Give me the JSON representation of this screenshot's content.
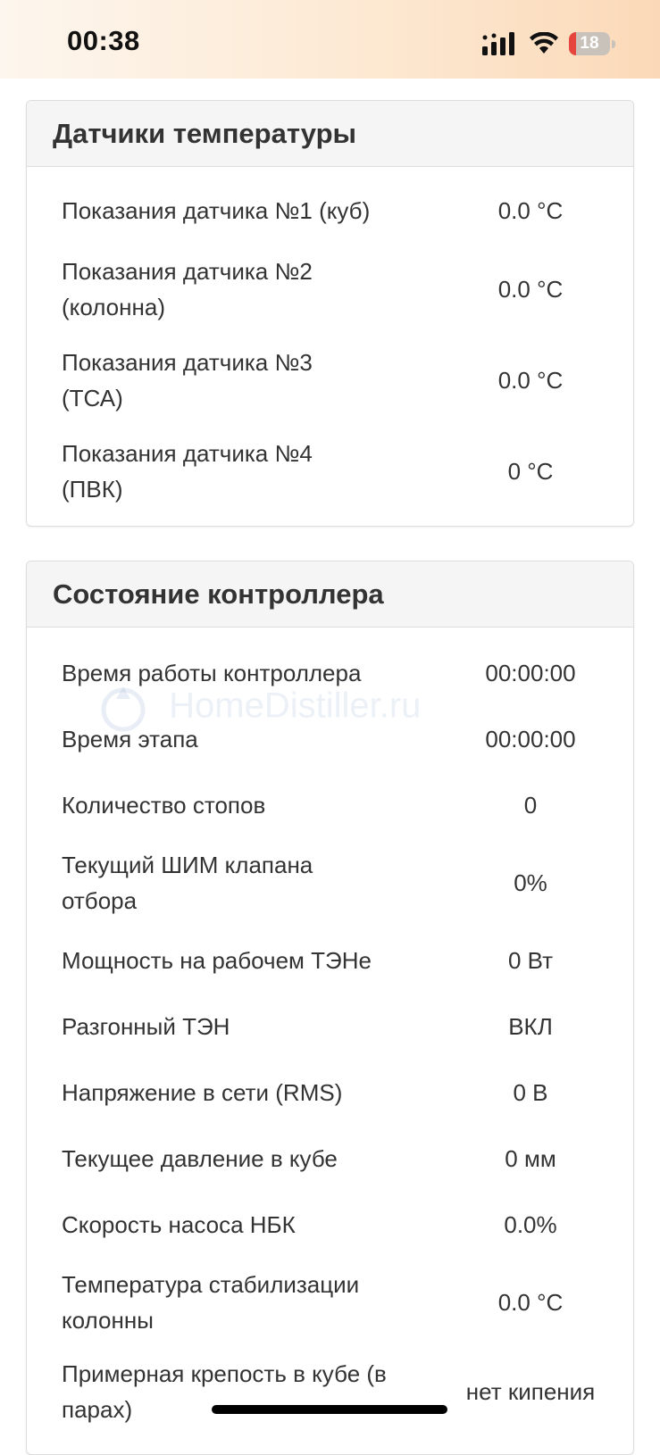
{
  "status_bar": {
    "time": "00:38",
    "battery_level": "18",
    "battery_fraction": 0.18,
    "icons": [
      "cellular-signal-icon",
      "wifi-icon",
      "battery-icon"
    ],
    "battery_color": "#e5453c"
  },
  "temperature_panel": {
    "title": "Датчики температуры",
    "rows": [
      {
        "label": "Показания датчика №1 (куб)",
        "value": "0.0 °C"
      },
      {
        "label": "Показания датчика №2 (колонна)",
        "value": "0.0 °C"
      },
      {
        "label": "Показания датчика №3 (ТСА)",
        "value": "0.0 °C"
      },
      {
        "label": "Показания датчика №4 (ПВК)",
        "value": "0 °C"
      }
    ]
  },
  "controller_panel": {
    "title": "Состояние контроллера",
    "rows": [
      {
        "label": "Время работы контроллера",
        "value": "00:00:00"
      },
      {
        "label": "Время этапа",
        "value": "00:00:00"
      },
      {
        "label": "Количество стопов",
        "value": "0"
      },
      {
        "label": "Текущий ШИМ клапана отбора",
        "value": "0%"
      },
      {
        "label": "Мощность на рабочем ТЭНе",
        "value": "0 Вт"
      },
      {
        "label": "Разгонный ТЭН",
        "value": "ВКЛ"
      },
      {
        "label": "Напряжение в сети (RMS)",
        "value": "0 В"
      },
      {
        "label": "Текущее давление в кубе",
        "value": "0 мм"
      },
      {
        "label": "Скорость насоса НБК",
        "value": "0.0%"
      },
      {
        "label": "Температура стабилизации колонны",
        "value": "0.0 °C"
      },
      {
        "label": "Примерная крепость в кубе (в парах)",
        "value": "нет кипения"
      }
    ]
  },
  "watermark": {
    "text": "HomeDistiller.ru"
  }
}
